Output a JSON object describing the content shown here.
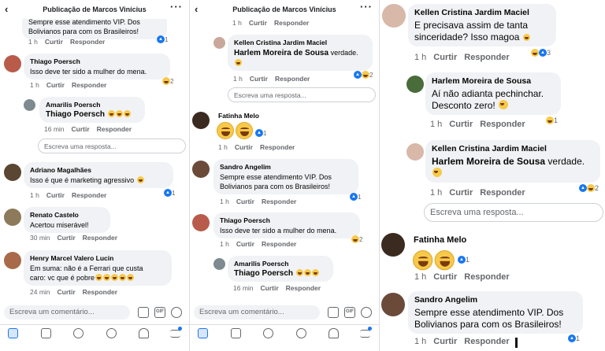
{
  "post_title": "Publicação de Marcos Vinícius",
  "actions": {
    "like": "Curtir",
    "reply": "Responder"
  },
  "reply_placeholder": "Escreva uma resposta...",
  "comment_placeholder": "Escreva um comentário...",
  "gif_label": "GIF",
  "colors": {
    "accent": "#1877f2",
    "bubble": "#f0f2f5",
    "meta": "#65676b"
  },
  "panel1": {
    "top_lines": [
      "Sempre esse atendimento VIP. Dos",
      "Bolivianos para com os Brasileiros!"
    ],
    "top_time": "1 h",
    "top_count": "1",
    "comments": [
      {
        "name": "Thiago Poersch",
        "text": "Isso deve ter sido a mulher do mena.",
        "time": "1 h",
        "count": "2"
      },
      {
        "name": "Amarilis Poersch",
        "text": "Thiago Poersch",
        "time": "16 min"
      },
      {
        "name": "Adriano Magalhães",
        "text": "Isso é que é marketing agressivo",
        "time": "1 h",
        "count": "1"
      },
      {
        "name": "Renato Castelo",
        "text": "Acertou miserável!",
        "time": "30 min"
      },
      {
        "name": "Henry Marcel Valero Lucin",
        "text1": "Em suma: não é a Ferrari que custa",
        "text2": "caro: vc que é pobre",
        "time": "24 min"
      }
    ]
  },
  "panel2": {
    "top_time": "1 h",
    "comments": [
      {
        "name": "Kellen Cristina Jardim Maciel",
        "mention": "Harlem Moreira de Sousa",
        "text": "verdade.",
        "time": "1 h",
        "count": "2"
      },
      {
        "name": "Fatinha Melo",
        "time": "1 h",
        "count": "1"
      },
      {
        "name": "Sandro Angelim",
        "text1": "Sempre esse atendimento VIP. Dos",
        "text2": "Bolivianos para com os Brasileiros!",
        "time": "1 h",
        "count": "1"
      },
      {
        "name": "Thiago Poersch",
        "text": "Isso deve ter sido a mulher do mena.",
        "time": "1 h",
        "count": "2"
      },
      {
        "name": "Amarilis Poersch",
        "text": "Thiago Poersch",
        "time": "16 min"
      }
    ]
  },
  "panel3": {
    "comments": [
      {
        "name": "Kellen Cristina Jardim Maciel",
        "text1": "E precisava assim de tanta",
        "text2": "sinceridade? Isso magoa",
        "time": "1 h",
        "count": "3"
      },
      {
        "name": "Harlem Moreira de Sousa",
        "text1": "Aí não adianta pechinchar.",
        "text2": "Desconto zero!",
        "time": "1 h",
        "count": "1"
      },
      {
        "name": "Kellen Cristina Jardim Maciel",
        "mention": "Harlem Moreira de Sousa",
        "text": "verdade.",
        "time": "1 h",
        "count": "2"
      },
      {
        "name": "Fatinha Melo",
        "time": "1 h",
        "count": "1"
      },
      {
        "name": "Sandro Angelim",
        "text1": "Sempre esse atendimento VIP. Dos",
        "text2": "Bolivianos para com os Brasileiros!",
        "time": "1 h",
        "count": "1"
      }
    ]
  }
}
